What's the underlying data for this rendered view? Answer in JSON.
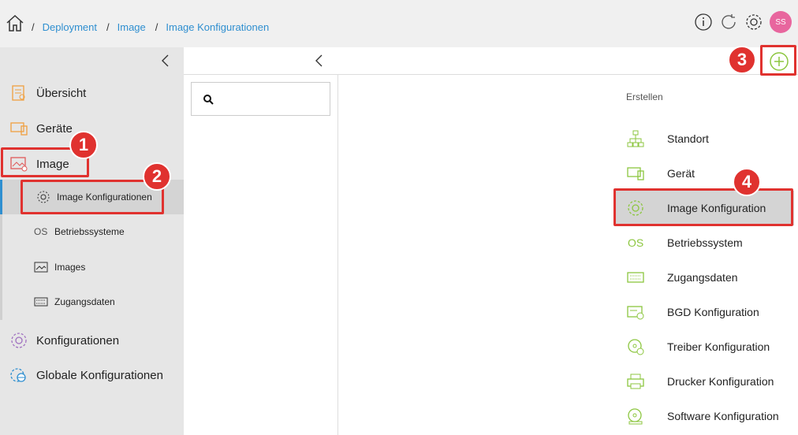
{
  "breadcrumb": {
    "sep": "/",
    "items": [
      "Deployment",
      "Image",
      "Image Konfigurationen"
    ]
  },
  "topbar": {
    "avatar_initials": "SS",
    "icons": [
      "info-icon",
      "refresh-icon",
      "settings-icon"
    ]
  },
  "sidebar": {
    "items": [
      {
        "label": "Übersicht",
        "icon": "overview-icon"
      },
      {
        "label": "Geräte",
        "icon": "devices-icon"
      },
      {
        "label": "Image",
        "icon": "image-icon"
      },
      {
        "label": "Konfigurationen",
        "icon": "configurations-icon"
      },
      {
        "label": "Globale Konfigurationen",
        "icon": "global-config-icon"
      }
    ],
    "subitems": [
      {
        "label": "Image Konfigurationen",
        "icon": "gear-icon"
      },
      {
        "label": "Betriebssysteme",
        "icon": "os-icon",
        "icon_text": "OS"
      },
      {
        "label": "Images",
        "icon": "image-icon"
      },
      {
        "label": "Zugangsdaten",
        "icon": "credentials-icon"
      }
    ]
  },
  "create_menu": {
    "title": "Erstellen",
    "items": [
      {
        "label": "Standort",
        "icon": "sitemap-icon"
      },
      {
        "label": "Gerät",
        "icon": "device-icon"
      },
      {
        "label": "Image Konfiguration",
        "icon": "gear-icon"
      },
      {
        "label": "Betriebssystem",
        "icon": "os-icon",
        "icon_text": "OS"
      },
      {
        "label": "Zugangsdaten",
        "icon": "credentials-icon"
      },
      {
        "label": "BGD Konfiguration",
        "icon": "bgd-icon"
      },
      {
        "label": "Treiber Konfiguration",
        "icon": "driver-icon"
      },
      {
        "label": "Drucker Konfiguration",
        "icon": "printer-icon"
      },
      {
        "label": "Software Konfiguration",
        "icon": "software-icon"
      }
    ]
  },
  "annotations": [
    "1",
    "2",
    "3",
    "4"
  ],
  "colors": {
    "accent": "#8cc63f",
    "link": "#2f8fd0",
    "annotation": "#e0322f",
    "avatar": "#e8669e"
  }
}
